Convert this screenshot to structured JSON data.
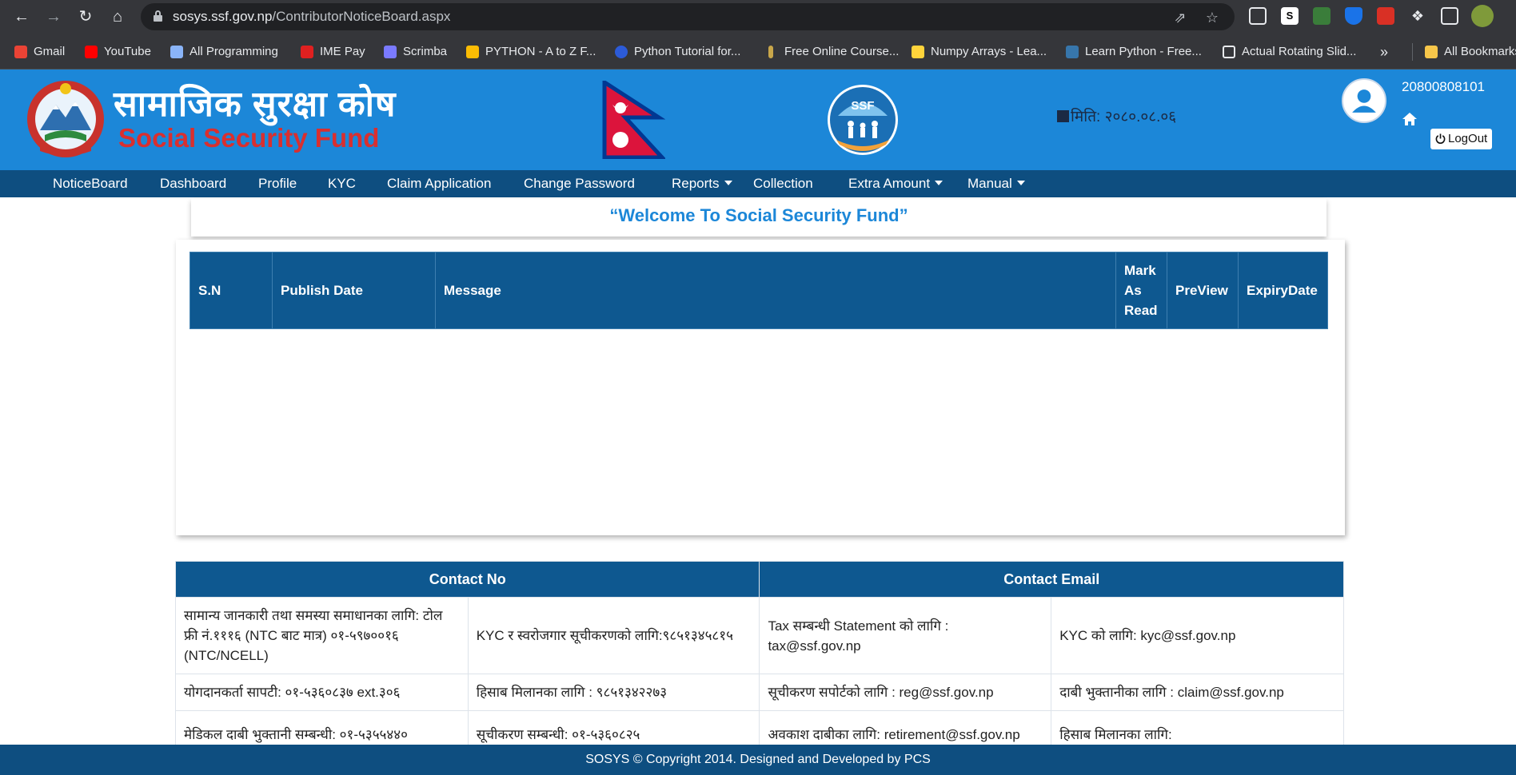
{
  "browser": {
    "url_host": "sosys.ssf.gov.np",
    "url_path": "/ContributorNoticeBoard.aspx",
    "bookmarks": [
      {
        "label": "Gmail",
        "color": "#ea4335"
      },
      {
        "label": "YouTube",
        "color": "#ff0000"
      },
      {
        "label": "All Programming",
        "color": "#8ab4f8"
      },
      {
        "label": "IME Pay",
        "color": "#e02020"
      },
      {
        "label": "Scrimba",
        "color": "#7a7aff"
      },
      {
        "label": "PYTHON - A to Z F...",
        "color": "#fbbc04"
      },
      {
        "label": "Python Tutorial for...",
        "color": "#2c5bd8"
      },
      {
        "label": "Free Online Course...",
        "color": "#c8a64a"
      },
      {
        "label": "Numpy Arrays - Lea...",
        "color": "#ffd43b"
      },
      {
        "label": "Learn Python - Free...",
        "color": "#3776ab"
      },
      {
        "label": "Actual Rotating Slid...",
        "color": "#e8eaed"
      }
    ],
    "more_bookmarks": "»",
    "all_bookmarks": "All Bookmarks"
  },
  "header": {
    "title_np": "सामाजिक सुरक्षा कोष",
    "title_en": "Social Security Fund",
    "date": "मिति: २०८०.०८.०६",
    "contributor_id": "20800808101",
    "logout": "LogOut",
    "ssf_badge": "SSF"
  },
  "nav": [
    {
      "label": "NoticeBoard",
      "dropdown": false
    },
    {
      "label": "Dashboard",
      "dropdown": false
    },
    {
      "label": "Profile",
      "dropdown": false
    },
    {
      "label": "KYC",
      "dropdown": false
    },
    {
      "label": "Claim Application",
      "dropdown": false
    },
    {
      "label": "Change Password",
      "dropdown": false
    },
    {
      "label": "Reports",
      "dropdown": true
    },
    {
      "label": "Collection",
      "dropdown": false
    },
    {
      "label": "Extra Amount",
      "dropdown": true
    },
    {
      "label": "Manual",
      "dropdown": true
    }
  ],
  "welcome": "“Welcome To Social Security Fund”",
  "notice_table": {
    "headers": [
      "S.N",
      "Publish  Date",
      "Message",
      "Mark As Read",
      "PreView",
      "ExpiryDate"
    ],
    "rows": []
  },
  "contact": {
    "headers": [
      "Contact  No",
      "Contact  Email"
    ],
    "rows": [
      [
        "सामान्य जानकारी तथा समस्या समाधानका लागि: टोल फ्री नं.१११६ (NTC बाट मात्र) ०१-५९७००१६ (NTC/NCELL)",
        "KYC र स्वरोजगार सूचीकरणको लागि:९८५१३४५८१५",
        "Tax सम्बन्धी Statement को लागि : tax@ssf.gov.np",
        "KYC को लागि: kyc@ssf.gov.np"
      ],
      [
        "योगदानकर्ता सापटी: ०१-५३६०८३७ ext.३०६",
        "हिसाब मिलानका लागि : ९८५१३४२२७३",
        "सूचीकरण सपोर्टको लागि : reg@ssf.gov.np",
        "दाबी भुक्तानीका लागि : claim@ssf.gov.np"
      ],
      [
        "मेडिकल दाबी भुक्तानी सम्बन्धी: ०१-५३५५४४०",
        "सूचीकरण सम्बन्धी: ०१-५३६०८२५",
        "अवकाश दाबीका लागि: retirement@ssf.gov.np",
        "हिसाब मिलानका लागि:"
      ]
    ]
  },
  "footer": "SOSYS © Copyright 2014. Designed and Developed by PCS"
}
